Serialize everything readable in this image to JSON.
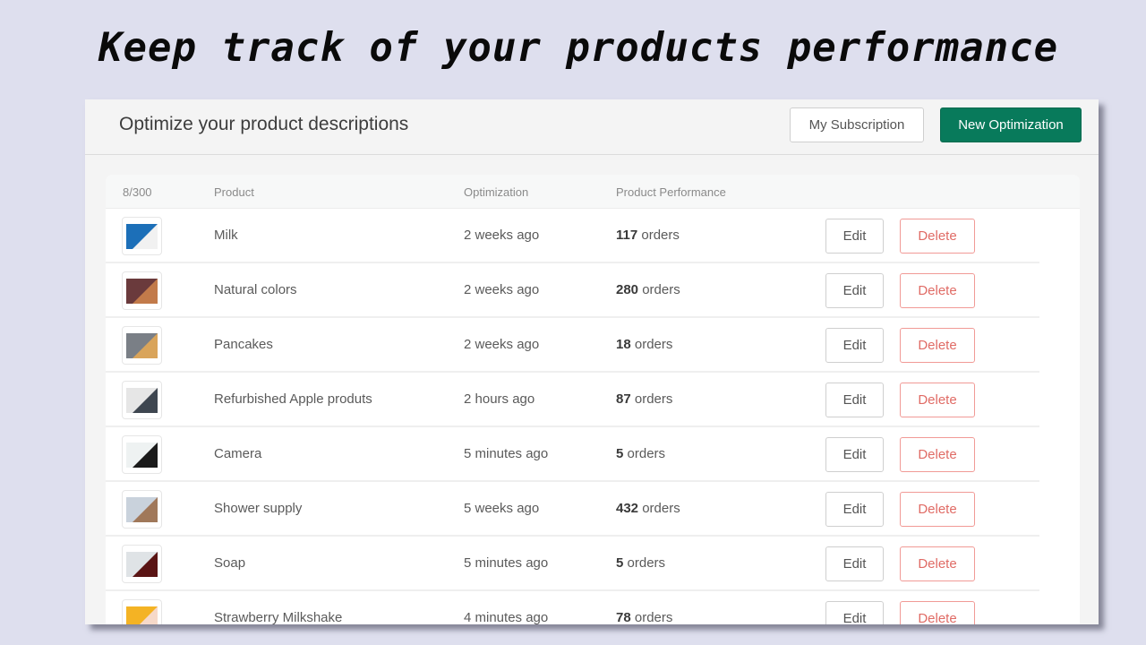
{
  "headline": "Keep track of your products performance",
  "header": {
    "title": "Optimize your product descriptions",
    "subscription_label": "My Subscription",
    "new_optimization_label": "New Optimization"
  },
  "table": {
    "columns": {
      "count": "8/300",
      "product": "Product",
      "optimization": "Optimization",
      "performance": "Product Performance"
    },
    "edit_label": "Edit",
    "delete_label": "Delete",
    "orders_suffix": "orders",
    "rows": [
      {
        "product": "Milk",
        "optimization": "2 weeks ago",
        "orders": "117",
        "thumb": "milk-image",
        "colors": [
          "#1c6fb8",
          "#f1f1f1"
        ]
      },
      {
        "product": "Natural colors",
        "optimization": "2 weeks ago",
        "orders": "280",
        "thumb": "natural-colors-image",
        "colors": [
          "#6a3a3c",
          "#c27a4a"
        ]
      },
      {
        "product": "Pancakes",
        "optimization": "2 weeks ago",
        "orders": "18",
        "thumb": "pancakes-image",
        "colors": [
          "#7a7f86",
          "#d9a45a"
        ]
      },
      {
        "product": "Refurbished Apple produts",
        "optimization": "2 hours ago",
        "orders": "87",
        "thumb": "apple-products-image",
        "colors": [
          "#e6e6e6",
          "#3e4650"
        ]
      },
      {
        "product": "Camera",
        "optimization": "5 minutes ago",
        "orders": "5",
        "thumb": "camera-image",
        "colors": [
          "#eef2f2",
          "#1a1a1a"
        ]
      },
      {
        "product": "Shower supply",
        "optimization": "5 weeks ago",
        "orders": "432",
        "thumb": "shower-supply-image",
        "colors": [
          "#c9d2dc",
          "#a0785a"
        ]
      },
      {
        "product": "Soap",
        "optimization": "5 minutes ago",
        "orders": "5",
        "thumb": "soap-image",
        "colors": [
          "#dfe3e6",
          "#5a1414"
        ]
      },
      {
        "product": "Strawberry Milkshake",
        "optimization": "4 minutes ago",
        "orders": "78",
        "thumb": "strawberry-milkshake-image",
        "colors": [
          "#f4b324",
          "#f6d9c9"
        ]
      }
    ]
  }
}
